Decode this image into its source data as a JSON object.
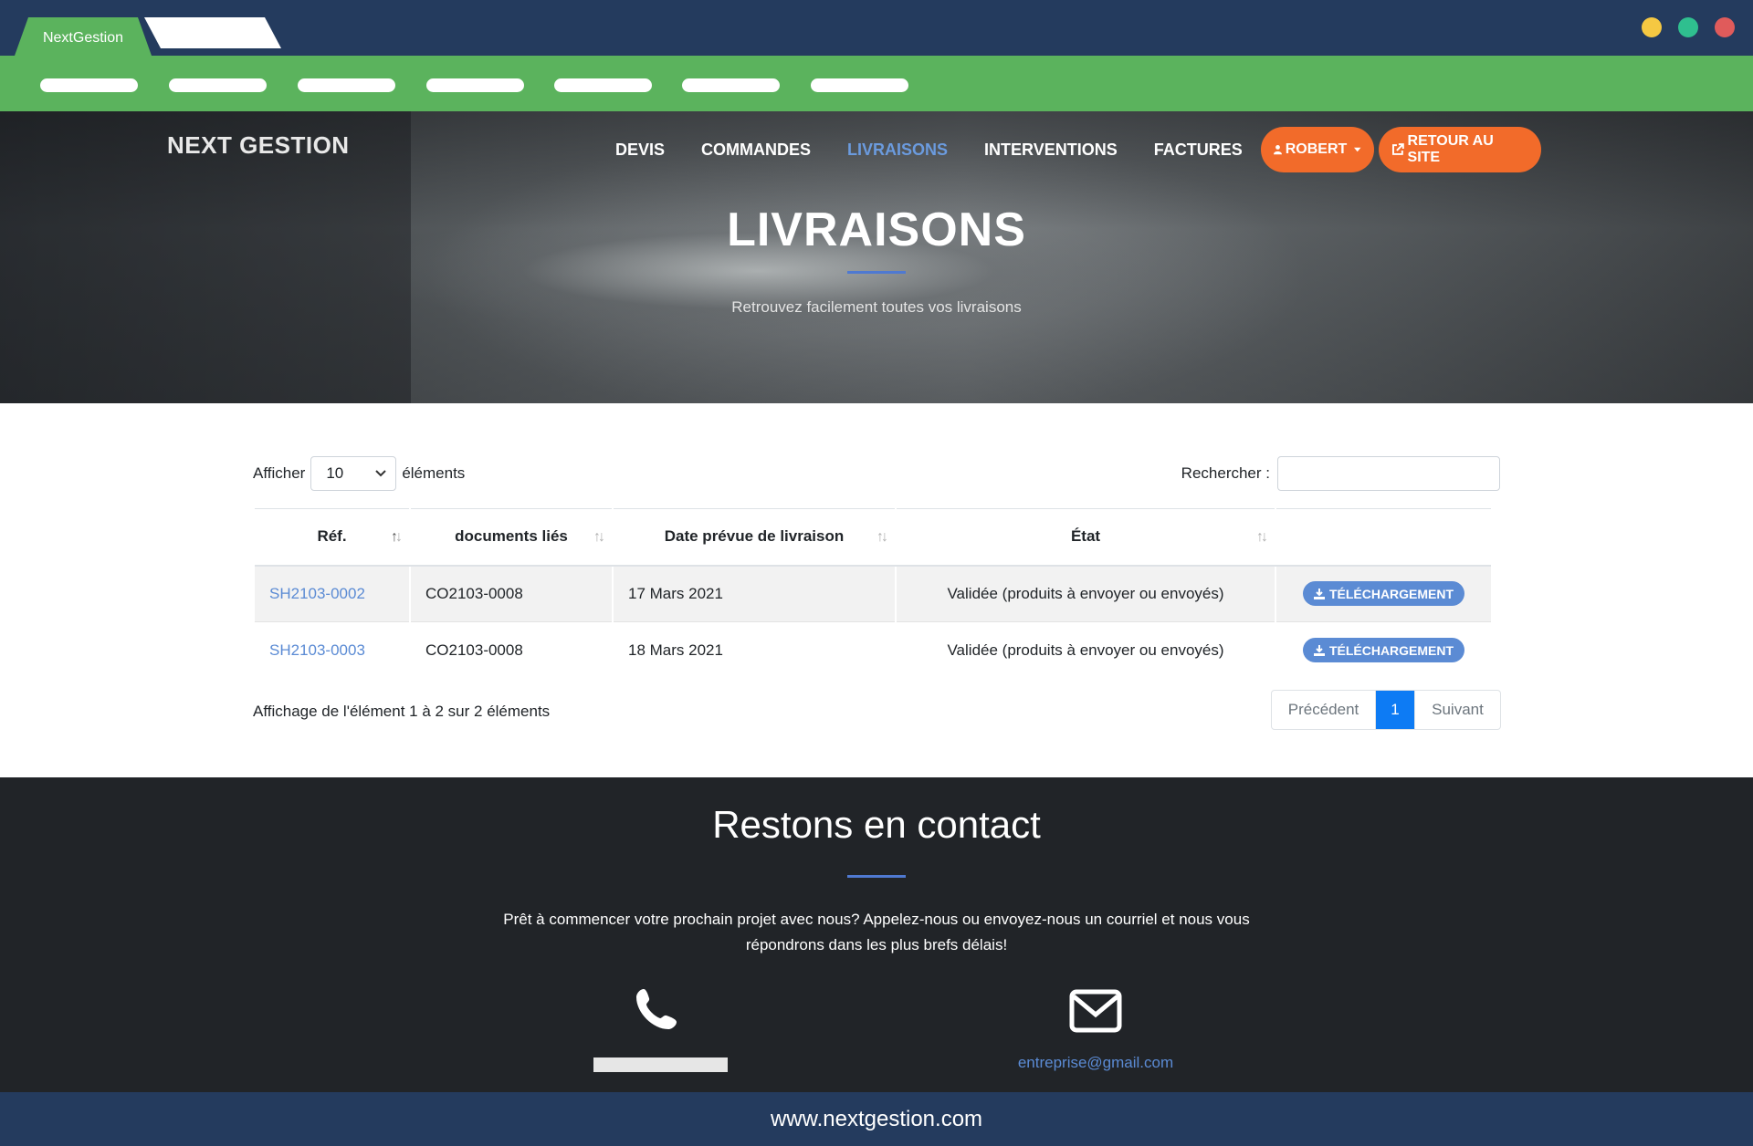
{
  "browser": {
    "tab_label": "NextGestion",
    "dot_colors": [
      "#f5c842",
      "#2fbf8f",
      "#e05b5b"
    ],
    "url_footer": "www.nextgestion.com"
  },
  "header": {
    "brand": "NEXT GESTION",
    "nav": [
      "DEVIS",
      "COMMANDES",
      "LIVRAISONS",
      "INTERVENTIONS",
      "FACTURES"
    ],
    "active_nav": "LIVRAISONS",
    "user_button": "ROBERT",
    "back_button": "RETOUR AU SITE"
  },
  "hero": {
    "title": "LIVRAISONS",
    "subtitle": "Retrouvez facilement toutes vos livraisons"
  },
  "controls": {
    "show_label": "Afficher",
    "page_size": "10",
    "elements_label": "éléments",
    "search_label": "Rechercher :",
    "search_value": ""
  },
  "table": {
    "headers": [
      "Réf.",
      "documents liés",
      "Date prévue de livraison",
      "État",
      ""
    ],
    "rows": [
      {
        "ref": "SH2103-0002",
        "doc": "CO2103-0008",
        "date": "17 Mars 2021",
        "etat": "Validée (produits à envoyer ou envoyés)",
        "action": "TÉLÉCHARGEMENT"
      },
      {
        "ref": "SH2103-0003",
        "doc": "CO2103-0008",
        "date": "18 Mars 2021",
        "etat": "Validée (produits à envoyer ou envoyés)",
        "action": "TÉLÉCHARGEMENT"
      }
    ]
  },
  "pagination": {
    "info": "Affichage de l'élément 1 à 2 sur 2 éléments",
    "prev": "Précédent",
    "current": "1",
    "next": "Suivant"
  },
  "footer": {
    "title": "Restons en contact",
    "text": "Prêt à commencer votre prochain projet avec nous? Appelez-nous ou envoyez-nous un courriel et nous vous répondrons dans les plus brefs délais!",
    "email": "entreprise@gmail.com"
  },
  "colors": {
    "chrome": "#243b5e",
    "green": "#5bb35d",
    "orange": "#f26b2a",
    "link": "#5b8bd4",
    "page_active": "#0d7bf4"
  }
}
